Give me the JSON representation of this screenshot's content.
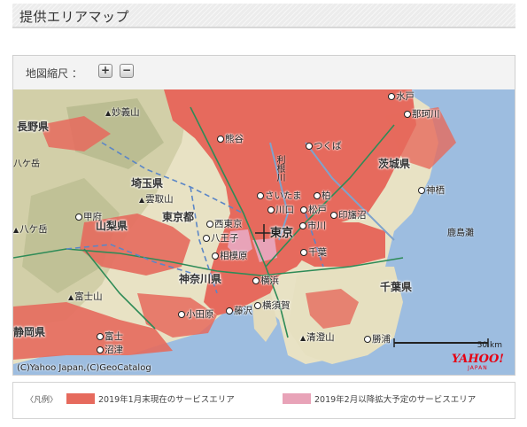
{
  "page": {
    "title": "提供エリアマップ"
  },
  "zoom": {
    "label": "地図縮尺 ：",
    "in": "+",
    "out": "−"
  },
  "map": {
    "prefectures": [
      "長野県",
      "埼玉県",
      "山梨県",
      "東京都",
      "神奈川県",
      "静岡県",
      "茨城県",
      "千葉県"
    ],
    "cities": {
      "mito": "水戸",
      "namegata": "那珂川",
      "kumagaya": "熊谷",
      "tsukuba": "つくば",
      "saitama": "さいたま",
      "kawaguchi": "川口",
      "matsudo": "松戸",
      "kashiwa": "柏",
      "inzai": "印旛沼",
      "kamisu": "神栖",
      "nishitokyo": "西東京",
      "hachioji": "八王子",
      "kofu": "甲府",
      "sagamihara": "相模原",
      "yokohama": "横浜",
      "fujisawa": "藤沢",
      "yokosuka": "横須賀",
      "odawara": "小田原",
      "chiba": "千葉",
      "ichikawa": "市川",
      "kisarazu": "清澄山",
      "katsuura": "勝浦",
      "fuji": "富士",
      "numazu": "沼津",
      "kashimanada": "鹿島灘",
      "hakusan": "八ケ岳",
      "tone": "利根川"
    },
    "big": {
      "tokyo": "東京"
    },
    "mountains": {
      "myogi": "妙義山",
      "kumotori": "雲取山",
      "fuji": "富士山",
      "yatsu": "八ケ岳",
      "kiyosumi": "清澄山"
    },
    "copyright": "(C)Yahoo Japan,(C)GeoCatalog",
    "scale": "50 km",
    "logo": {
      "main": "YAHOO!",
      "sub": "JAPAN"
    }
  },
  "legend": {
    "label": "〈凡例〉",
    "items": [
      {
        "text": "2019年1月末現在のサービスエリア",
        "color": "#e66a5d"
      },
      {
        "text": "2019年2月以降拡大予定のサービスエリア",
        "color": "#e8a3b8"
      }
    ]
  }
}
